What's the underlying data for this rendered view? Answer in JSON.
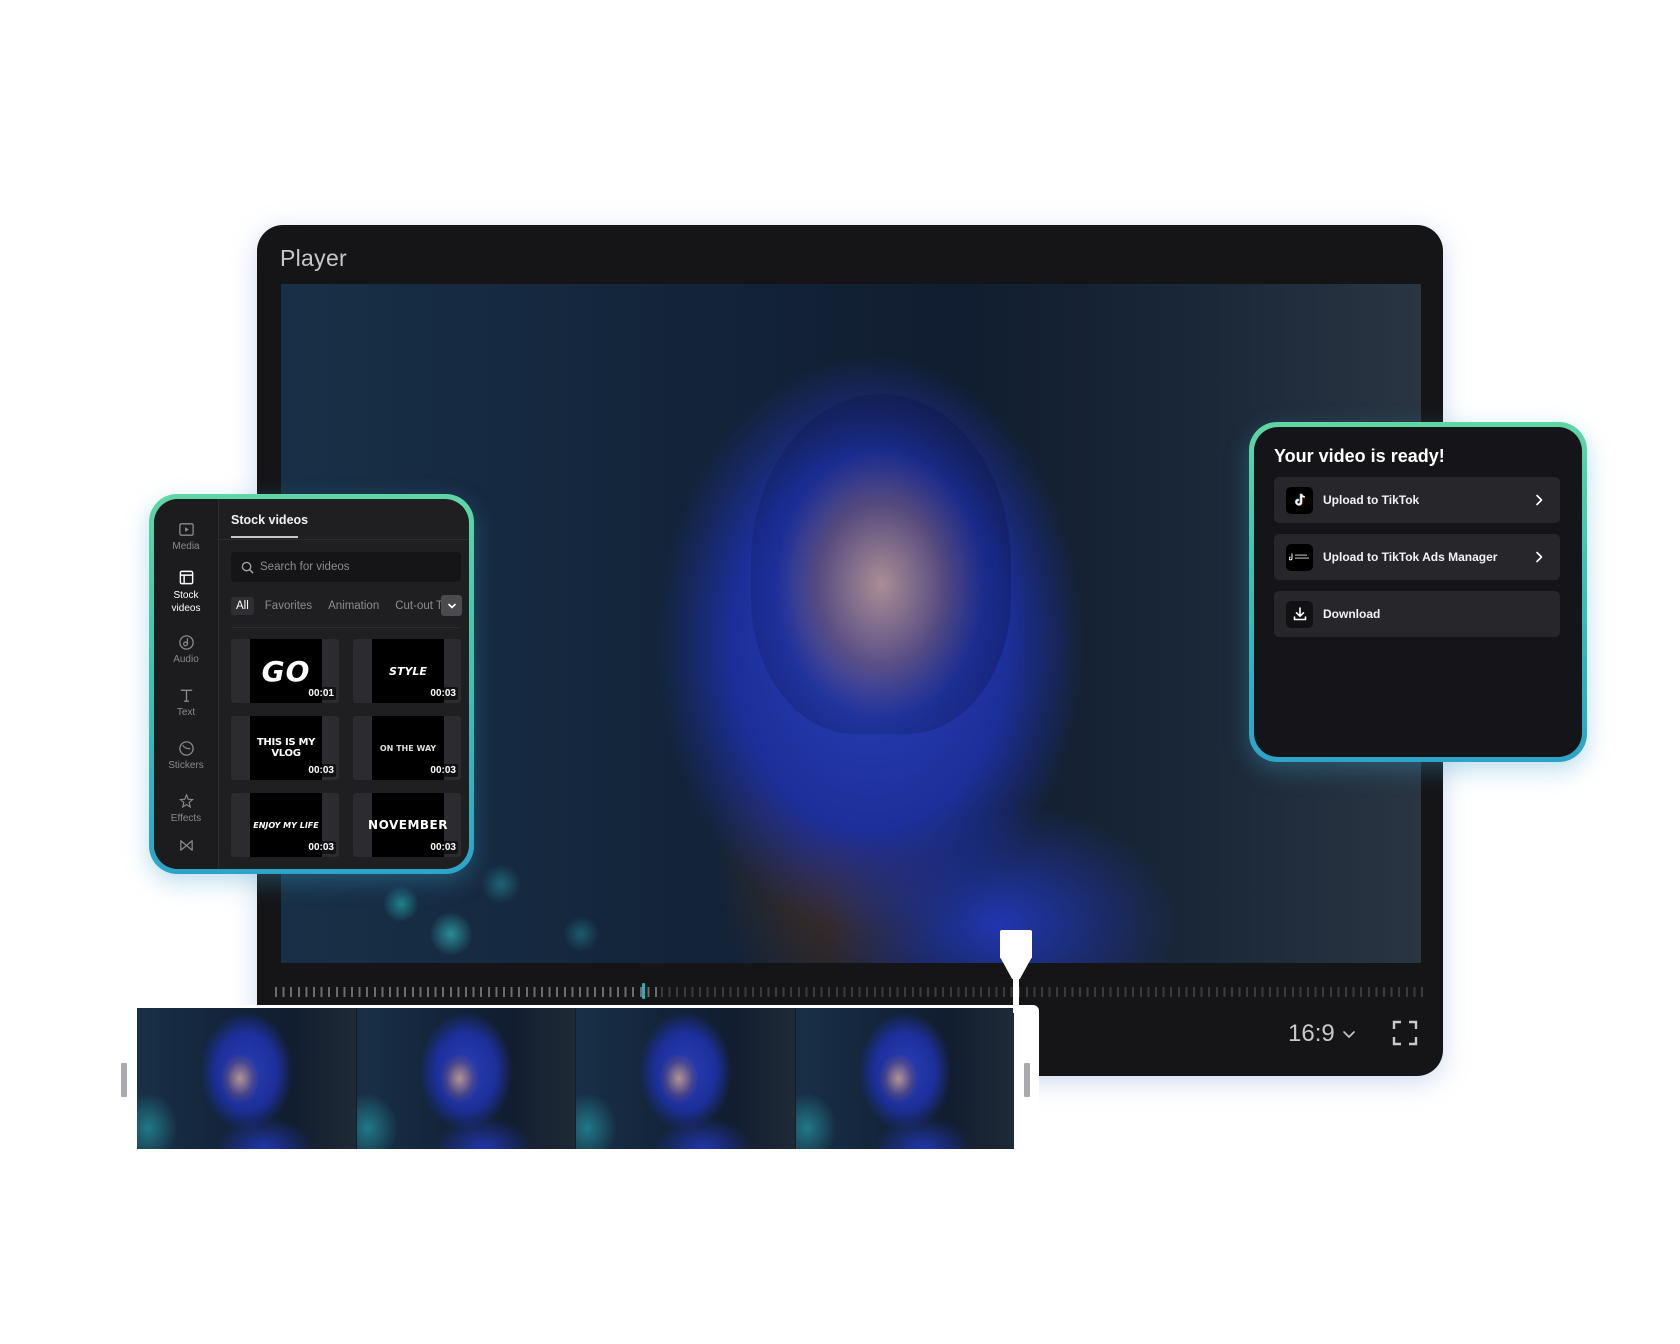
{
  "player": {
    "title": "Player",
    "aspect_ratio": "16:9",
    "timeline_progress_fraction": 0.32,
    "playhead_fraction": 0.64,
    "accent_color": "#1fb3b8"
  },
  "filmstrip": {
    "frame_count": 4
  },
  "stock_panel": {
    "rail": [
      {
        "label": "Media",
        "icon": "media-icon"
      },
      {
        "label": "Stock videos",
        "icon": "stock-videos-icon",
        "active": true
      },
      {
        "label": "Audio",
        "icon": "audio-icon"
      },
      {
        "label": "Text",
        "icon": "text-icon"
      },
      {
        "label": "Stickers",
        "icon": "stickers-icon"
      },
      {
        "label": "Effects",
        "icon": "effects-icon"
      },
      {
        "label": "",
        "icon": "transitions-icon"
      }
    ],
    "tab_label": "Stock videos",
    "search_placeholder": "Search for videos",
    "filters": [
      "All",
      "Favorites",
      "Animation",
      "Cut-out T"
    ],
    "active_filter": "All",
    "thumbnails": [
      {
        "title": "GO",
        "duration": "00:01"
      },
      {
        "title": "STYLE",
        "duration": "00:03"
      },
      {
        "title": "THIS IS MY VLOG",
        "duration": "00:03"
      },
      {
        "title": "ON THE WAY",
        "duration": "00:03"
      },
      {
        "title": "ENJOY MY LIFE",
        "duration": "00:03"
      },
      {
        "title": "NOVEMBER",
        "duration": "00:03"
      }
    ],
    "border_gradient": [
      "#5fd6a4",
      "#2ea3c9"
    ]
  },
  "ready_panel": {
    "title": "Your video is ready!",
    "buttons": [
      {
        "label": "Upload to TikTok",
        "icon": "tiktok-icon",
        "has_chevron": true
      },
      {
        "label": "Upload to TikTok Ads Manager",
        "icon": "tiktok-ads-manager-icon",
        "has_chevron": true
      },
      {
        "label": "Download",
        "icon": "download-icon",
        "has_chevron": false
      }
    ]
  }
}
